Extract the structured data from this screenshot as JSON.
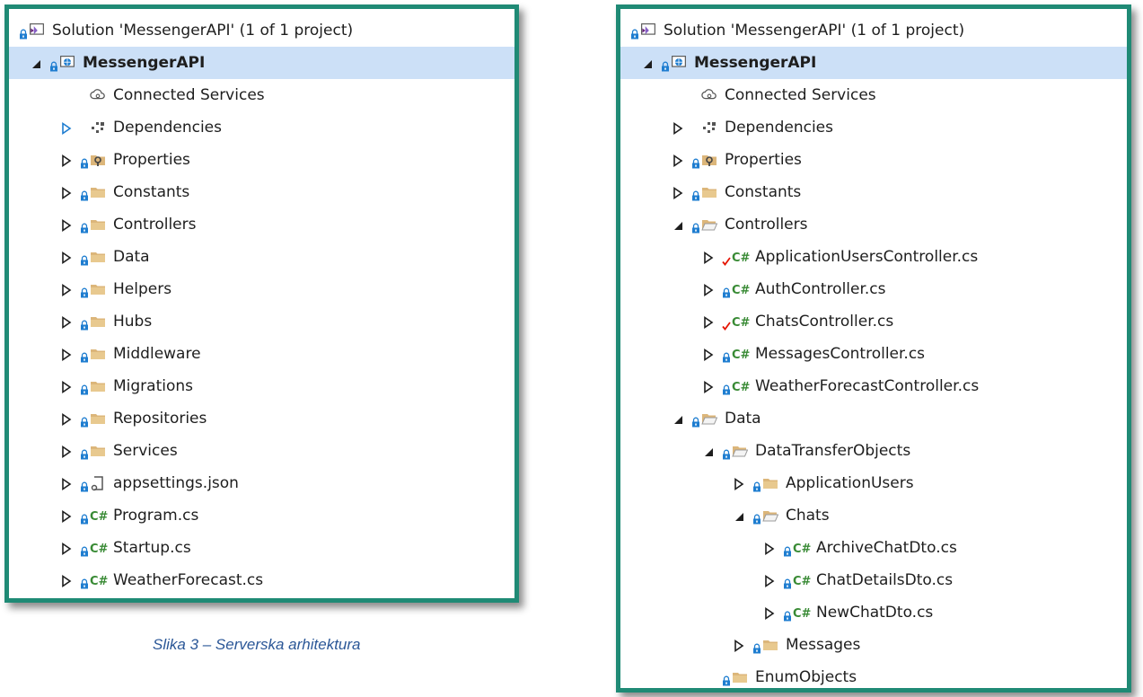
{
  "left_tree": [
    {
      "label": "Solution 'MessengerAPI' (1 of 1 project)",
      "depth": 0,
      "expander": "none",
      "lock": true,
      "icon": "solution-icon",
      "bold": false,
      "selected": false
    },
    {
      "label": "MessengerAPI",
      "depth": 1,
      "expander": "expanded",
      "lock": true,
      "icon": "web-project-icon",
      "bold": true,
      "selected": true
    },
    {
      "label": "Connected Services",
      "depth": 2,
      "expander": "none",
      "lock": false,
      "icon": "cloud-icon",
      "bold": false,
      "selected": false
    },
    {
      "label": "Dependencies",
      "depth": 2,
      "expander": "collapsed-blue",
      "lock": false,
      "icon": "dependencies-icon",
      "bold": false,
      "selected": false
    },
    {
      "label": "Properties",
      "depth": 2,
      "expander": "collapsed",
      "lock": true,
      "icon": "properties-folder-icon",
      "bold": false,
      "selected": false
    },
    {
      "label": "Constants",
      "depth": 2,
      "expander": "collapsed",
      "lock": true,
      "icon": "folder-icon",
      "bold": false,
      "selected": false
    },
    {
      "label": "Controllers",
      "depth": 2,
      "expander": "collapsed",
      "lock": true,
      "icon": "folder-icon",
      "bold": false,
      "selected": false
    },
    {
      "label": "Data",
      "depth": 2,
      "expander": "collapsed",
      "lock": true,
      "icon": "folder-icon",
      "bold": false,
      "selected": false
    },
    {
      "label": "Helpers",
      "depth": 2,
      "expander": "collapsed",
      "lock": true,
      "icon": "folder-icon",
      "bold": false,
      "selected": false
    },
    {
      "label": "Hubs",
      "depth": 2,
      "expander": "collapsed",
      "lock": true,
      "icon": "folder-icon",
      "bold": false,
      "selected": false
    },
    {
      "label": "Middleware",
      "depth": 2,
      "expander": "collapsed",
      "lock": true,
      "icon": "folder-icon",
      "bold": false,
      "selected": false
    },
    {
      "label": "Migrations",
      "depth": 2,
      "expander": "collapsed",
      "lock": true,
      "icon": "folder-icon",
      "bold": false,
      "selected": false
    },
    {
      "label": "Repositories",
      "depth": 2,
      "expander": "collapsed",
      "lock": true,
      "icon": "folder-icon",
      "bold": false,
      "selected": false
    },
    {
      "label": "Services",
      "depth": 2,
      "expander": "collapsed",
      "lock": true,
      "icon": "folder-icon",
      "bold": false,
      "selected": false
    },
    {
      "label": "appsettings.json",
      "depth": 2,
      "expander": "collapsed",
      "lock": true,
      "icon": "json-file-icon",
      "bold": false,
      "selected": false
    },
    {
      "label": "Program.cs",
      "depth": 2,
      "expander": "collapsed",
      "lock": true,
      "icon": "csharp-file-icon",
      "bold": false,
      "selected": false
    },
    {
      "label": "Startup.cs",
      "depth": 2,
      "expander": "collapsed",
      "lock": true,
      "icon": "csharp-file-icon",
      "bold": false,
      "selected": false
    },
    {
      "label": "WeatherForecast.cs",
      "depth": 2,
      "expander": "collapsed",
      "lock": true,
      "icon": "csharp-file-icon",
      "bold": false,
      "selected": false
    }
  ],
  "right_tree": [
    {
      "label": "Solution 'MessengerAPI' (1 of 1 project)",
      "depth": 0,
      "expander": "none",
      "lock": true,
      "icon": "solution-icon",
      "bold": false,
      "selected": false
    },
    {
      "label": "MessengerAPI",
      "depth": 1,
      "expander": "expanded",
      "lock": true,
      "icon": "web-project-icon",
      "bold": true,
      "selected": true
    },
    {
      "label": "Connected Services",
      "depth": 2,
      "expander": "none",
      "lock": false,
      "icon": "cloud-icon",
      "bold": false,
      "selected": false
    },
    {
      "label": "Dependencies",
      "depth": 2,
      "expander": "collapsed",
      "lock": false,
      "icon": "dependencies-icon",
      "bold": false,
      "selected": false
    },
    {
      "label": "Properties",
      "depth": 2,
      "expander": "collapsed",
      "lock": true,
      "icon": "properties-folder-icon",
      "bold": false,
      "selected": false
    },
    {
      "label": "Constants",
      "depth": 2,
      "expander": "collapsed",
      "lock": true,
      "icon": "folder-icon",
      "bold": false,
      "selected": false
    },
    {
      "label": "Controllers",
      "depth": 2,
      "expander": "expanded",
      "lock": true,
      "icon": "folder-open-icon",
      "bold": false,
      "selected": false
    },
    {
      "label": "ApplicationUsersController.cs",
      "depth": 3,
      "expander": "collapsed",
      "lock": false,
      "check": true,
      "icon": "csharp-file-icon",
      "bold": false,
      "selected": false
    },
    {
      "label": "AuthController.cs",
      "depth": 3,
      "expander": "collapsed",
      "lock": true,
      "icon": "csharp-file-icon",
      "bold": false,
      "selected": false
    },
    {
      "label": "ChatsController.cs",
      "depth": 3,
      "expander": "collapsed",
      "lock": false,
      "check": true,
      "icon": "csharp-file-icon",
      "bold": false,
      "selected": false
    },
    {
      "label": "MessagesController.cs",
      "depth": 3,
      "expander": "collapsed",
      "lock": true,
      "icon": "csharp-file-icon",
      "bold": false,
      "selected": false
    },
    {
      "label": "WeatherForecastController.cs",
      "depth": 3,
      "expander": "collapsed",
      "lock": true,
      "icon": "csharp-file-icon",
      "bold": false,
      "selected": false
    },
    {
      "label": "Data",
      "depth": 2,
      "expander": "expanded",
      "lock": true,
      "icon": "folder-open-icon",
      "bold": false,
      "selected": false
    },
    {
      "label": "DataTransferObjects",
      "depth": 3,
      "expander": "expanded",
      "lock": true,
      "icon": "folder-open-icon",
      "bold": false,
      "selected": false
    },
    {
      "label": "ApplicationUsers",
      "depth": 4,
      "expander": "collapsed",
      "lock": true,
      "icon": "folder-icon",
      "bold": false,
      "selected": false
    },
    {
      "label": "Chats",
      "depth": 4,
      "expander": "expanded",
      "lock": true,
      "icon": "folder-open-icon",
      "bold": false,
      "selected": false
    },
    {
      "label": "ArchiveChatDto.cs",
      "depth": 5,
      "expander": "collapsed",
      "lock": true,
      "icon": "csharp-file-icon",
      "bold": false,
      "selected": false
    },
    {
      "label": "ChatDetailsDto.cs",
      "depth": 5,
      "expander": "collapsed",
      "lock": true,
      "icon": "csharp-file-icon",
      "bold": false,
      "selected": false
    },
    {
      "label": "NewChatDto.cs",
      "depth": 5,
      "expander": "collapsed",
      "lock": true,
      "icon": "csharp-file-icon",
      "bold": false,
      "selected": false
    },
    {
      "label": "Messages",
      "depth": 4,
      "expander": "collapsed",
      "lock": true,
      "icon": "folder-icon",
      "bold": false,
      "selected": false
    },
    {
      "label": "EnumObjects",
      "depth": 3,
      "expander": "none",
      "lock": true,
      "icon": "folder-icon",
      "bold": false,
      "selected": false
    }
  ],
  "caption": "Slika 3 – Serverska arhitektura",
  "colors": {
    "border": "#1f8a75",
    "selection": "#cce0f7",
    "folder": "#dcb67a",
    "csharp": "#388a34",
    "lock": "#1e7dd0",
    "check": "#e51400",
    "caption": "#2b5797"
  }
}
